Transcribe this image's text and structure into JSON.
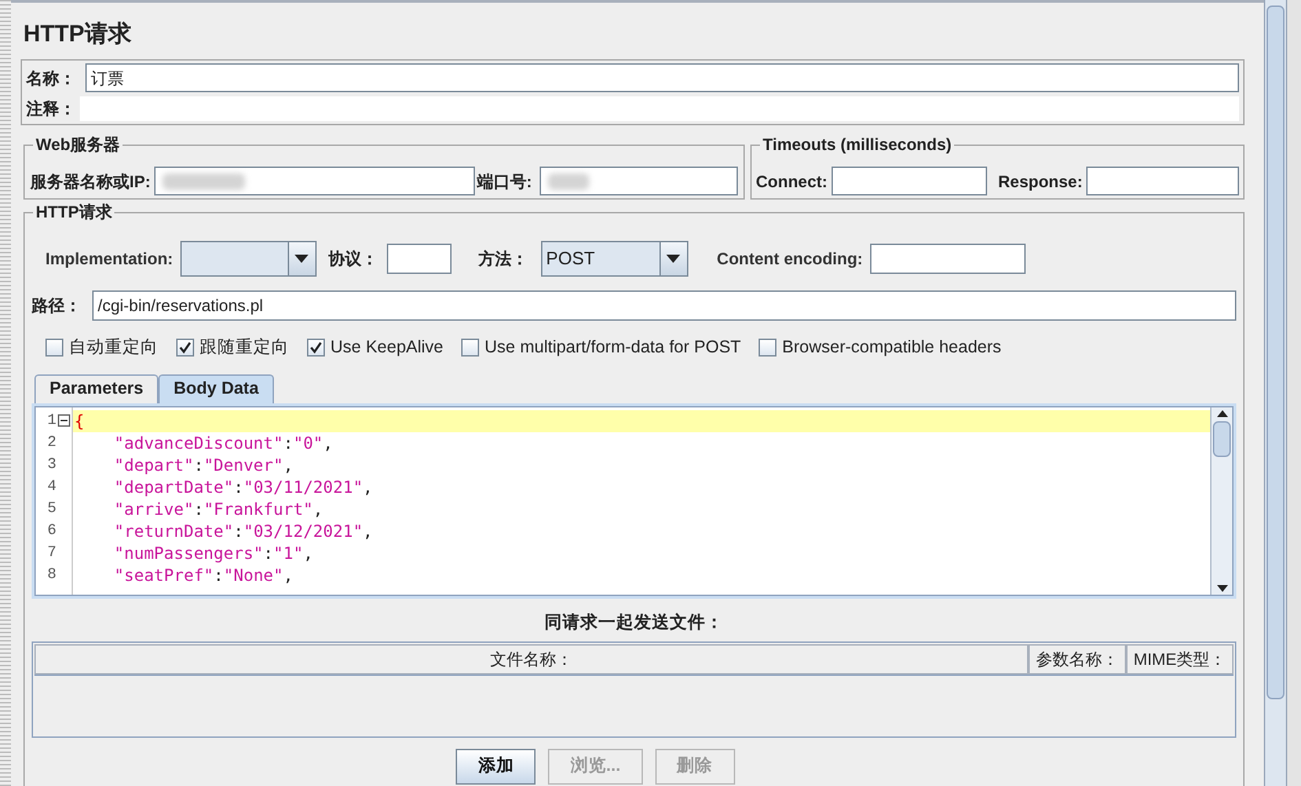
{
  "title": "HTTP请求",
  "name_field": {
    "label": "名称：",
    "value": "订票"
  },
  "comment_field": {
    "label": "注释："
  },
  "web_server": {
    "legend": "Web服务器",
    "server_label": "服务器名称或IP:",
    "port_label": "端口号:"
  },
  "timeouts": {
    "legend": "Timeouts (milliseconds)",
    "connect_label": "Connect:",
    "response_label": "Response:"
  },
  "http_request": {
    "legend": "HTTP请求",
    "implementation": {
      "label": "Implementation:"
    },
    "protocol": {
      "label": "协议："
    },
    "method": {
      "label": "方法：",
      "value": "POST"
    },
    "content_encoding": {
      "label": "Content encoding:"
    },
    "path": {
      "label": "路径：",
      "value": "/cgi-bin/reservations.pl"
    },
    "options": [
      {
        "label": "自动重定向",
        "checked": false
      },
      {
        "label": "跟随重定向",
        "checked": true
      },
      {
        "label": "Use KeepAlive",
        "checked": true
      },
      {
        "label": "Use multipart/form-data for POST",
        "checked": false
      },
      {
        "label": "Browser-compatible headers",
        "checked": false
      }
    ],
    "tabs": [
      {
        "label": "Parameters",
        "selected": false
      },
      {
        "label": "Body Data",
        "selected": true
      }
    ],
    "body_data": {
      "lines": [
        {
          "number": "1",
          "text": "{",
          "current": true,
          "foldable": true
        },
        {
          "number": "2",
          "text": "    \"advanceDiscount\":\"0\",",
          "current": false,
          "foldable": false
        },
        {
          "number": "3",
          "text": "    \"depart\":\"Denver\",",
          "current": false,
          "foldable": false
        },
        {
          "number": "4",
          "text": "    \"departDate\":\"03/11/2021\",",
          "current": false,
          "foldable": false
        },
        {
          "number": "5",
          "text": "    \"arrive\":\"Frankfurt\",",
          "current": false,
          "foldable": false
        },
        {
          "number": "6",
          "text": "    \"returnDate\":\"03/12/2021\",",
          "current": false,
          "foldable": false
        },
        {
          "number": "7",
          "text": "    \"numPassengers\":\"1\",",
          "current": false,
          "foldable": false
        },
        {
          "number": "8",
          "text": "    \"seatPref\":\"None\",",
          "current": false,
          "foldable": false
        }
      ]
    }
  },
  "files": {
    "title": "同请求一起发送文件：",
    "columns": [
      "文件名称：",
      "参数名称：",
      "MIME类型："
    ],
    "buttons": [
      {
        "label": "添加",
        "disabled": false
      },
      {
        "label": "浏览...",
        "disabled": true
      },
      {
        "label": "删除",
        "disabled": true
      }
    ]
  }
}
